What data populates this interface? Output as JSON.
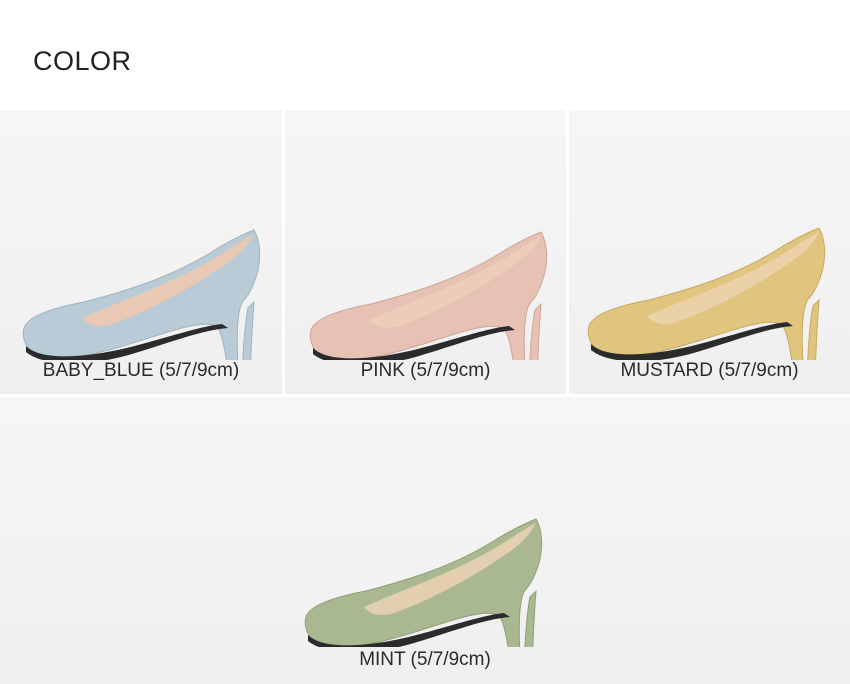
{
  "heading": "COLOR",
  "products": [
    {
      "label": "BABY_BLUE (5/7/9cm)",
      "color": "#b8cbd6",
      "shade": "#9fb3bf",
      "lining": "#e9c9b4"
    },
    {
      "label": "PINK (5/7/9cm)",
      "color": "#e6c1b4",
      "shade": "#cfa698",
      "lining": "#eccdb8"
    },
    {
      "label": "MUSTARD (5/7/9cm)",
      "color": "#e1c47e",
      "shade": "#c6aa63",
      "lining": "#ead1a8"
    },
    {
      "label": "MINT (5/7/9cm)",
      "color": "#aab891",
      "shade": "#909f78",
      "lining": "#e3cfb0"
    }
  ]
}
